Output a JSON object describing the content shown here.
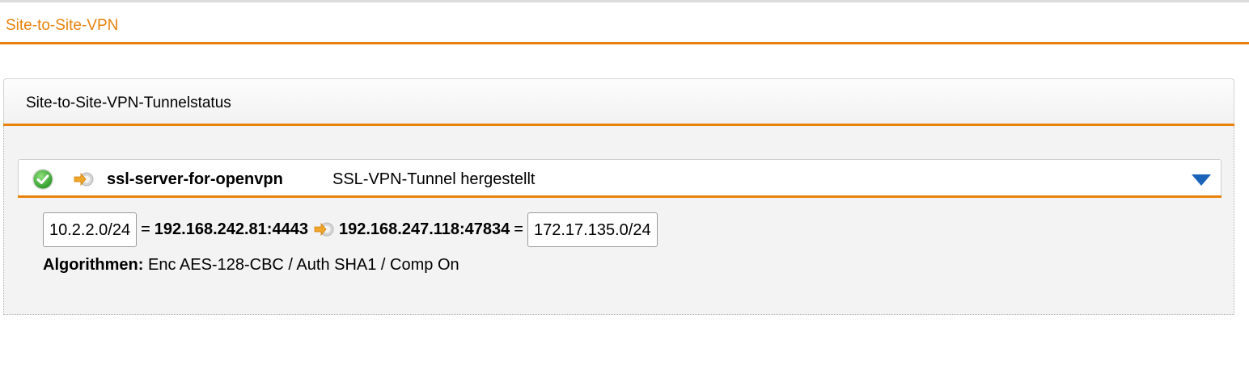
{
  "page": {
    "title": "Site-to-Site-VPN"
  },
  "panel": {
    "title": "Site-to-Site-VPN-Tunnelstatus"
  },
  "tunnel": {
    "name": "ssl-server-for-openvpn",
    "status_text": "SSL-VPN-Tunnel hergestellt",
    "status_icon": "check-circle-icon",
    "type_icon": "tunnel-arrow-icon",
    "expand_icon": "triangle-down-icon",
    "local_network": "10.2.2.0/24",
    "equals_1": "=",
    "local_endpoint": "192.168.242.81:4443",
    "remote_endpoint": "192.168.247.118:47834",
    "equals_2": "=",
    "remote_network": "172.17.135.0/24",
    "algorithms_label": "Algorithmen:",
    "algorithms_value": "Enc AES-128-CBC / Auth SHA1 / Comp On"
  },
  "colors": {
    "accent": "#e8820c",
    "ok_green": "#4bb543",
    "toggle_blue": "#1a63b8"
  }
}
